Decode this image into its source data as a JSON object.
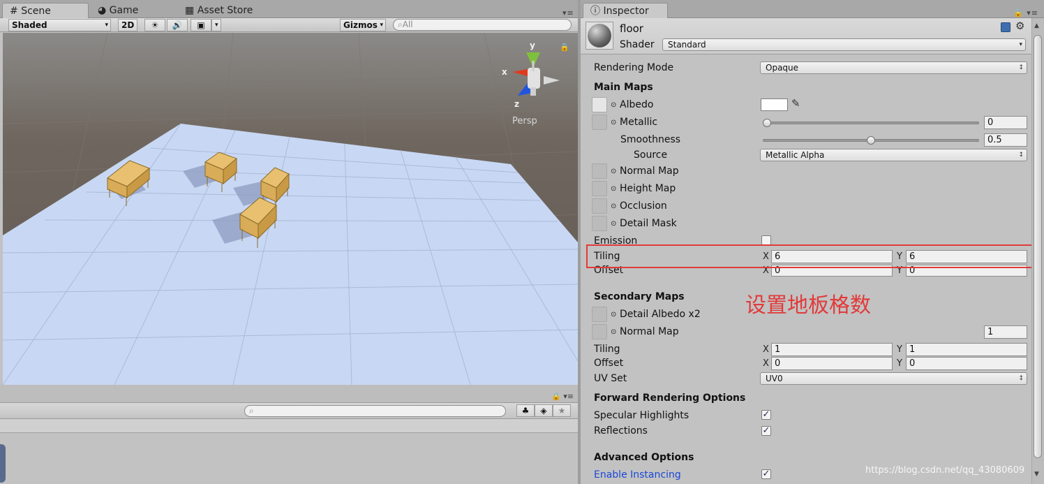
{
  "scene_tabs": [
    "Scene",
    "Game",
    "Asset Store"
  ],
  "scene_toolbar": {
    "shading": "Shaded",
    "mode_2d": "2D",
    "gizmos": "Gizmos",
    "search": "All"
  },
  "gizmo": {
    "x": "x",
    "y": "y",
    "z": "z",
    "persp": "Persp"
  },
  "inspector_tab": "Inspector",
  "material": {
    "name": "floor",
    "shader_label": "Shader",
    "shader": "Standard"
  },
  "rendering": {
    "label": "Rendering Mode",
    "value": "Opaque"
  },
  "main_maps": {
    "title": "Main Maps",
    "albedo": "Albedo",
    "metallic": "Metallic",
    "metallic_value": "0",
    "metallic_level": 0,
    "smoothness": "Smoothness",
    "smoothness_value": "0.5",
    "smoothness_level": 0.5,
    "source": "Source",
    "source_value": "Metallic Alpha",
    "normal_map": "Normal Map",
    "height_map": "Height Map",
    "occlusion": "Occlusion",
    "detail_mask": "Detail Mask",
    "emission": "Emission",
    "tiling": "Tiling",
    "tiling_x": "6",
    "tiling_y": "6",
    "offset": "Offset",
    "offset_x": "0",
    "offset_y": "0"
  },
  "annotation": "设置地板格数",
  "secondary_maps": {
    "title": "Secondary Maps",
    "detail_albedo": "Detail Albedo x2",
    "normal_map": "Normal Map",
    "normal_value": "1",
    "tiling": "Tiling",
    "tiling_x": "1",
    "tiling_y": "1",
    "offset": "Offset",
    "offset_x": "0",
    "offset_y": "0",
    "uv_set": "UV Set",
    "uv_value": "UV0"
  },
  "forward": {
    "title": "Forward Rendering Options",
    "specular": "Specular Highlights",
    "reflections": "Reflections"
  },
  "advanced": {
    "title": "Advanced Options",
    "instancing": "Enable Instancing"
  },
  "axis_x": "X",
  "axis_y": "Y",
  "watermark": "https://blog.csdn.net/qq_43080609",
  "colors": {
    "annotation_red": "#e23a3a",
    "plane": "#c8d8f4",
    "scene_bg": "#6c635b",
    "link_blue": "#1a48d6"
  }
}
